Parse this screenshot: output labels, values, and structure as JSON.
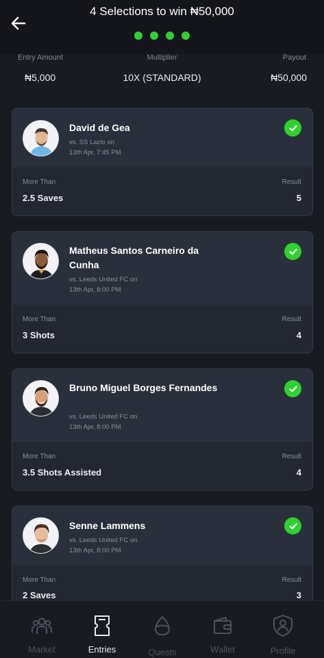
{
  "header": {
    "title": "4 Selections to win ₦50,000",
    "progress_dots": 4,
    "dot_color": "#2ed12e"
  },
  "summary": {
    "entry_label": "Entry Amount",
    "entry_value": "₦5,000",
    "multiplier_label": "Multiplier",
    "multiplier_value": "10X (STANDARD)",
    "payout_label": "Payout",
    "payout_value": "₦50,000"
  },
  "selections": [
    {
      "player": "David de Gea",
      "opponent": "vs. SS Lazio on",
      "datetime": "13th Apr, 7:45 PM",
      "more_label": "More Than",
      "stat": "2.5 Saves",
      "result_label": "Result",
      "result": "5",
      "status_icon": "check-circle-icon"
    },
    {
      "player": "Matheus Santos Carneiro da Cunha",
      "opponent": "vs. Leeds United FC on",
      "datetime": "13th Apr, 8:00 PM",
      "more_label": "More Than",
      "stat": "3 Shots",
      "result_label": "Result",
      "result": "4",
      "status_icon": "check-circle-icon"
    },
    {
      "player": "Bruno Miguel Borges Fernandes",
      "opponent": "vs. Leeds United FC on",
      "datetime": "13th Apr, 8:00 PM",
      "more_label": "More Than",
      "stat": "3.5 Shots Assisted",
      "result_label": "Result",
      "result": "4",
      "status_icon": "check-circle-icon"
    },
    {
      "player": "Senne Lammens",
      "opponent": "vs. Leeds United FC on",
      "datetime": "13th Apr, 8:00 PM",
      "more_label": "More Than",
      "stat": "2 Saves",
      "result_label": "Result",
      "result": "3",
      "status_icon": "check-circle-icon"
    }
  ],
  "nav": {
    "active": "Entries",
    "items": [
      {
        "label": "Market",
        "icon": "market-icon"
      },
      {
        "label": "Entries",
        "icon": "ticket-icon"
      },
      {
        "label": "Quests",
        "icon": "quests-icon"
      },
      {
        "label": "Wallet",
        "icon": "wallet-icon"
      },
      {
        "label": "Profile",
        "icon": "profile-shield-icon"
      }
    ]
  },
  "colors": {
    "background": "#181b22",
    "card": "#222731",
    "card_top": "#2a303b",
    "accent_green": "#2ed12e",
    "muted_text": "#8a909b"
  }
}
